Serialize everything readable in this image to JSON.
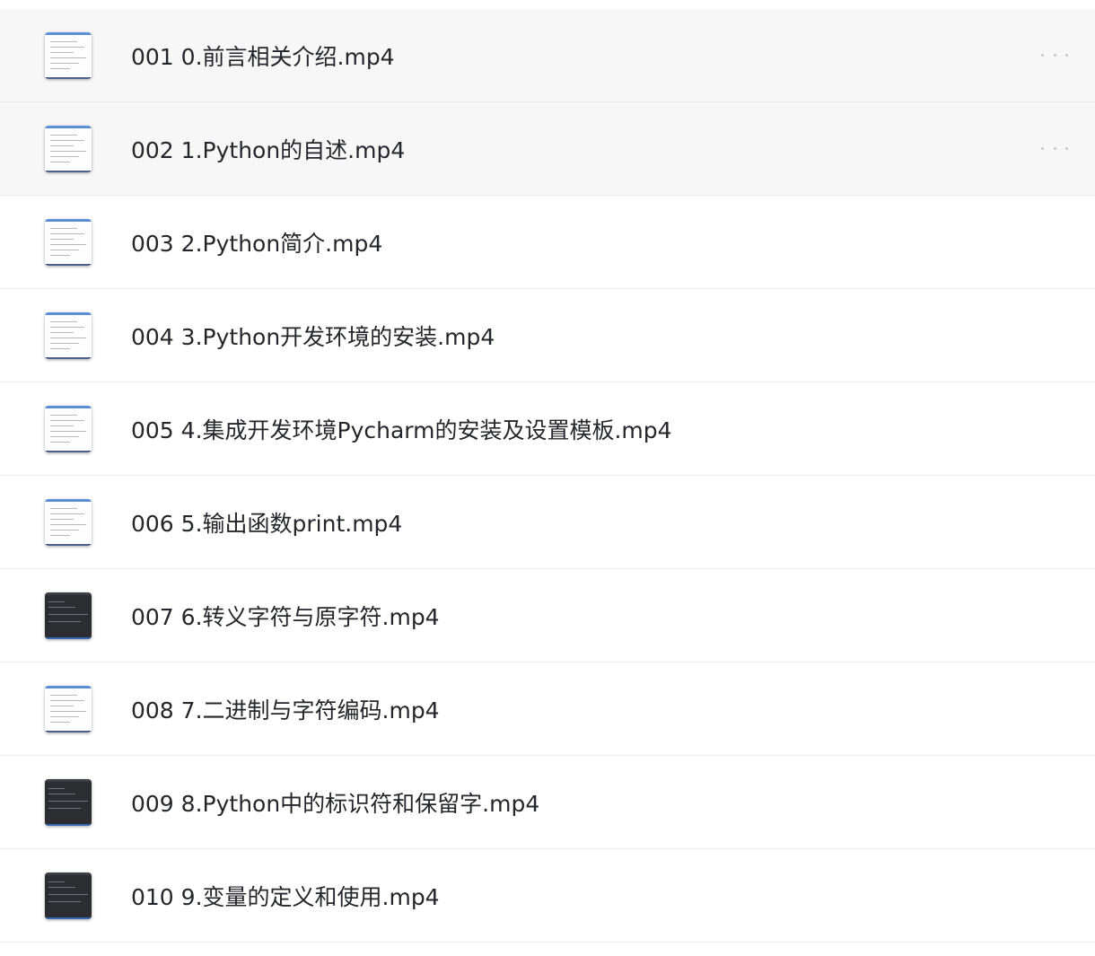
{
  "files": [
    {
      "name": "001 0.前言相关介绍.mp4",
      "thumb": "light",
      "show_more": true
    },
    {
      "name": "002 1.Python的自述.mp4",
      "thumb": "light",
      "show_more": true
    },
    {
      "name": "003 2.Python简介.mp4",
      "thumb": "light",
      "show_more": false
    },
    {
      "name": "004 3.Python开发环境的安装.mp4",
      "thumb": "light",
      "show_more": false
    },
    {
      "name": "005 4.集成开发环境Pycharm的安装及设置模板.mp4",
      "thumb": "light",
      "show_more": false
    },
    {
      "name": "006 5.输出函数print.mp4",
      "thumb": "light",
      "show_more": false
    },
    {
      "name": "007 6.转义字符与原字符.mp4",
      "thumb": "dark",
      "show_more": false
    },
    {
      "name": "008 7.二进制与字符编码.mp4",
      "thumb": "light",
      "show_more": false
    },
    {
      "name": "009 8.Python中的标识符和保留字.mp4",
      "thumb": "dark",
      "show_more": false
    },
    {
      "name": "010 9.变量的定义和使用.mp4",
      "thumb": "dark",
      "show_more": false
    }
  ],
  "more_icon": "more-horizontal-icon",
  "colors": {
    "row_hover": "#f7f7f7",
    "divider": "#ececec",
    "text": "#25262b",
    "more_dots": "#c4c6cc"
  }
}
